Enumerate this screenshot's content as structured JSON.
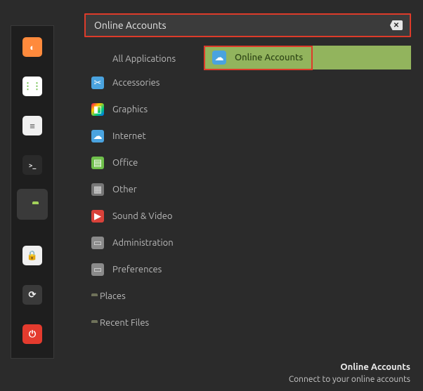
{
  "search": {
    "value": "Online Accounts"
  },
  "launcher": [
    {
      "name": "firefox",
      "color": "#ff8a3c",
      "glyph": "◐"
    },
    {
      "name": "apps",
      "color": "#6fbf4b",
      "glyph": "⋮⋮"
    },
    {
      "name": "settings-panel",
      "color": "#f0f0f0",
      "glyph": "≡"
    },
    {
      "name": "terminal",
      "color": "#2a2a2a",
      "glyph": ">_"
    },
    {
      "name": "files",
      "color": "#a3d15a",
      "glyph": ""
    },
    {
      "name": "lock",
      "color": "#f0f0f0",
      "glyph": "🔒"
    },
    {
      "name": "restart",
      "color": "#3a3a3a",
      "glyph": "⟳"
    },
    {
      "name": "power",
      "color": "#e43b2e",
      "glyph": "⏻"
    }
  ],
  "categories": [
    {
      "label": "All Applications",
      "icon": null
    },
    {
      "label": "Accessories",
      "icon": "scissors",
      "bg": "#4aa3df",
      "glyph": "✂"
    },
    {
      "label": "Graphics",
      "icon": "palette",
      "bg": "linear",
      "glyph": "◧"
    },
    {
      "label": "Internet",
      "icon": "cloud",
      "bg": "#4aa3df",
      "glyph": "☁"
    },
    {
      "label": "Office",
      "icon": "doc",
      "bg": "#6fbf4b",
      "glyph": "▤"
    },
    {
      "label": "Other",
      "icon": "grid",
      "bg": "#777777",
      "glyph": "▦"
    },
    {
      "label": "Sound & Video",
      "icon": "play",
      "bg": "#d9423a",
      "glyph": "▶"
    },
    {
      "label": "Administration",
      "icon": "admin",
      "bg": "#8a8a8a",
      "glyph": "▭"
    },
    {
      "label": "Preferences",
      "icon": "prefs",
      "bg": "#8a8a8a",
      "glyph": "▭"
    },
    {
      "label": "Places",
      "icon": "folder",
      "bg": "#6f725a",
      "glyph": ""
    },
    {
      "label": "Recent Files",
      "icon": "folder",
      "bg": "#6f725a",
      "glyph": ""
    }
  ],
  "results": [
    {
      "label": "Online Accounts",
      "icon": "cloud"
    }
  ],
  "tooltip": {
    "title": "Online Accounts",
    "subtitle": "Connect to your online accounts"
  }
}
